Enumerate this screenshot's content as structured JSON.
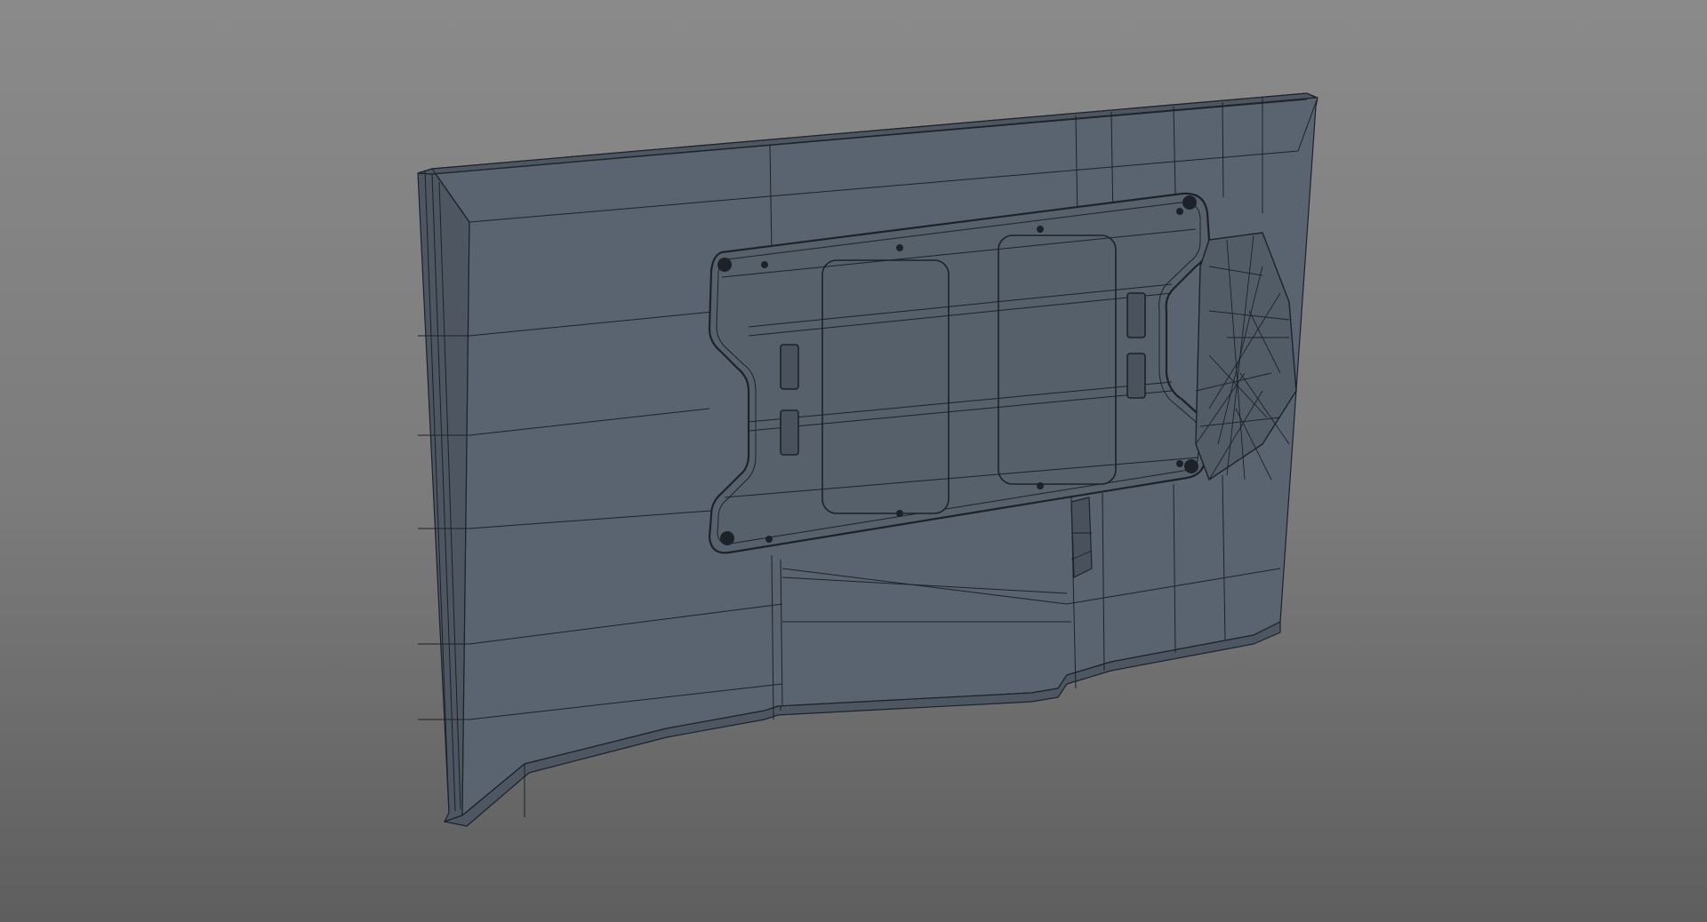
{
  "scene": {
    "subject": "tv-back-wireframe",
    "colors": {
      "background_top": "#8a8a8a",
      "background_bottom": "#5e5e5e",
      "body_fill": "#5a6470",
      "body_side_fill": "#4d5661",
      "bracket_fill": "#57616c",
      "wire": "#1c2228",
      "wire_light": "#2b333b"
    }
  }
}
